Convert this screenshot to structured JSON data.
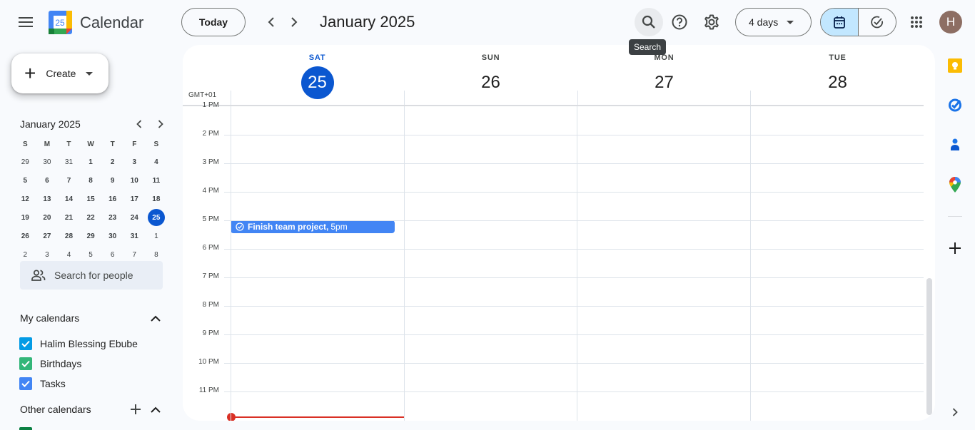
{
  "header": {
    "app_title": "Calendar",
    "logo_day": "25",
    "today_label": "Today",
    "period_title": "January 2025",
    "tooltip": "Search",
    "view_select": "4 days",
    "avatar_initial": "H",
    "icons": {
      "menu": "hamburger-menu-icon",
      "prev": "chevron-left-icon",
      "next": "chevron-right-icon",
      "search": "search-icon",
      "help": "help-icon",
      "settings": "gear-icon",
      "calendar_view": "calendar-icon",
      "tasks_view": "task-check-icon",
      "apps": "apps-grid-icon"
    }
  },
  "sidebar": {
    "create_label": "Create",
    "mini_calendar": {
      "title": "January 2025",
      "weekdays": [
        "S",
        "M",
        "T",
        "W",
        "T",
        "F",
        "S"
      ],
      "weeks": [
        [
          "29",
          "30",
          "31",
          "1",
          "2",
          "3",
          "4"
        ],
        [
          "5",
          "6",
          "7",
          "8",
          "9",
          "10",
          "11"
        ],
        [
          "12",
          "13",
          "14",
          "15",
          "16",
          "17",
          "18"
        ],
        [
          "19",
          "20",
          "21",
          "22",
          "23",
          "24",
          "25"
        ],
        [
          "26",
          "27",
          "28",
          "29",
          "30",
          "31",
          "1"
        ],
        [
          "2",
          "3",
          "4",
          "5",
          "6",
          "7",
          "8"
        ]
      ],
      "today": "25"
    },
    "people_search_placeholder": "Search for people",
    "my_calendars": {
      "title": "My calendars",
      "items": [
        {
          "label": "Halim Blessing Ebube",
          "color": "#039be5",
          "checked": true
        },
        {
          "label": "Birthdays",
          "color": "#33b679",
          "checked": true
        },
        {
          "label": "Tasks",
          "color": "#4285f4",
          "checked": true
        }
      ]
    },
    "other_calendars": {
      "title": "Other calendars"
    }
  },
  "main": {
    "timezone": "GMT+01",
    "days": [
      {
        "dow": "SAT",
        "date": "25",
        "today": true
      },
      {
        "dow": "SUN",
        "date": "26",
        "today": false
      },
      {
        "dow": "MON",
        "date": "27",
        "today": false
      },
      {
        "dow": "TUE",
        "date": "28",
        "today": false
      }
    ],
    "hours": [
      "1 PM",
      "2 PM",
      "3 PM",
      "4 PM",
      "5 PM",
      "6 PM",
      "7 PM",
      "8 PM",
      "9 PM",
      "10 PM",
      "11 PM"
    ],
    "events": [
      {
        "title": "Finish team project,",
        "time": "5pm",
        "day": "SAT",
        "color": "#4285f4",
        "type": "task"
      }
    ]
  },
  "side_panel": {
    "icons": [
      "keep-icon",
      "tasks-icon",
      "contacts-icon",
      "maps-icon",
      "add-icon",
      "expand-chevron-icon"
    ]
  }
}
